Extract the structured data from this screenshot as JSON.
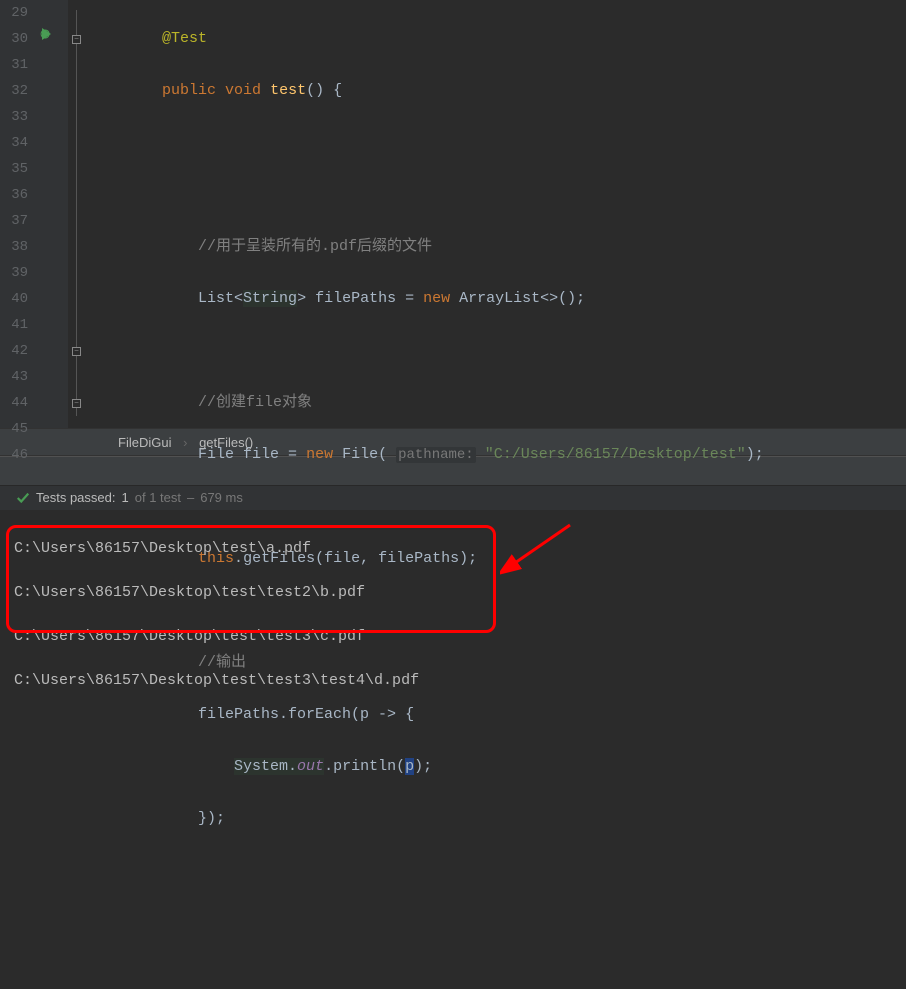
{
  "gutter": {
    "lines": [
      "29",
      "30",
      "31",
      "32",
      "33",
      "34",
      "35",
      "36",
      "37",
      "38",
      "39",
      "40",
      "41",
      "42",
      "43",
      "44",
      "45",
      "46"
    ]
  },
  "code": {
    "l29_anno": "@Test",
    "l30_kw1": "public",
    "l30_kw2": "void",
    "l30_meth": "test",
    "l30_rest": "() {",
    "l33_cmt": "//用于呈装所有的.pdf后缀的文件",
    "l34_a": "List<",
    "l34_b": "String",
    "l34_c": "> filePaths = ",
    "l34_kw": "new",
    "l34_d": " ArrayList<>();",
    "l36_cmt": "//创建file对象",
    "l37_a": "File file = ",
    "l37_kw": "new",
    "l37_b": " File( ",
    "l37_hint": "pathname:",
    "l37_sp": " ",
    "l37_str": "\"C:/Users/86157/Desktop/test\"",
    "l37_c": ");",
    "l39_kw": "this",
    "l39_a": ".",
    "l39_meth": "getFiles",
    "l39_b": "(file, filePaths);",
    "l41_cmt": "//输出",
    "l42_a": "filePaths.forEach(p -> {",
    "l43_a": "System.",
    "l43_field": "out",
    "l43_b": ".println(",
    "l43_p": "p",
    "l43_c": ");",
    "l44_a": "});"
  },
  "breadcrumb": {
    "class": "FileDiGui",
    "method": "getFiles()"
  },
  "tests": {
    "label": "Tests passed:",
    "passed": "1",
    "of_label": "of 1 test",
    "dash": "–",
    "time": "679 ms"
  },
  "console": {
    "l1": "C:\\Users\\86157\\Desktop\\test\\a.pdf",
    "l2": "C:\\Users\\86157\\Desktop\\test\\test2\\b.pdf",
    "l3": "C:\\Users\\86157\\Desktop\\test\\test3\\c.pdf",
    "l4": "C:\\Users\\86157\\Desktop\\test\\test3\\test4\\d.pdf"
  }
}
